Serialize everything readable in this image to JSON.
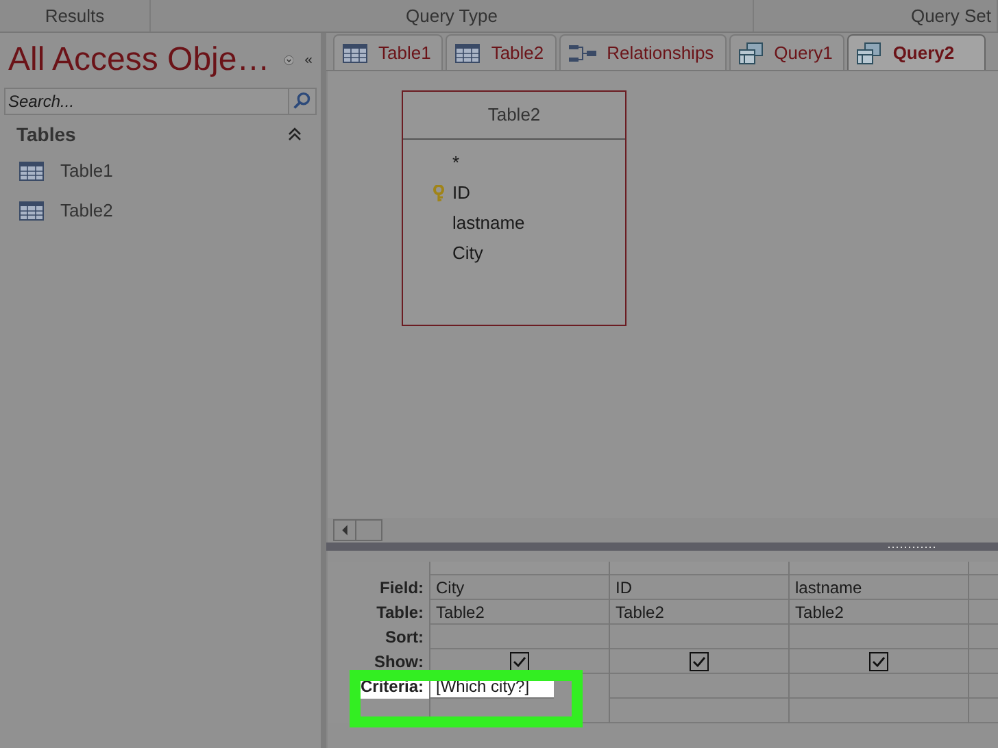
{
  "ribbon": {
    "groups": [
      "Results",
      "Query Type",
      "Query Set"
    ]
  },
  "navigation_pane": {
    "title": "All Access Obje…",
    "search": {
      "placeholder": "Search..."
    },
    "sections": [
      {
        "label": "Tables",
        "expanded": true,
        "items": [
          {
            "label": "Table1"
          },
          {
            "label": "Table2"
          }
        ]
      }
    ]
  },
  "tabs": [
    {
      "label": "Table1",
      "kind": "table",
      "selected": false
    },
    {
      "label": "Table2",
      "kind": "table",
      "selected": false
    },
    {
      "label": "Relationships",
      "kind": "relationships",
      "selected": false
    },
    {
      "label": "Query1",
      "kind": "query",
      "selected": false
    },
    {
      "label": "Query2",
      "kind": "query",
      "selected": true
    }
  ],
  "table_box": {
    "title": "Table2",
    "fields": [
      {
        "name": "*",
        "key": false
      },
      {
        "name": "ID",
        "key": true
      },
      {
        "name": "lastname",
        "key": false
      },
      {
        "name": "City",
        "key": false
      }
    ]
  },
  "query_grid": {
    "row_labels": [
      "Field:",
      "Table:",
      "Sort:",
      "Show:",
      "Criteria:"
    ],
    "criteria_highlighted": true,
    "columns": [
      {
        "field": "City",
        "table": "Table2",
        "show": true,
        "criteria": "[Which city?]"
      },
      {
        "field": "ID",
        "table": "Table2",
        "show": true
      },
      {
        "field": "lastname",
        "table": "Table2",
        "show": true
      }
    ]
  }
}
